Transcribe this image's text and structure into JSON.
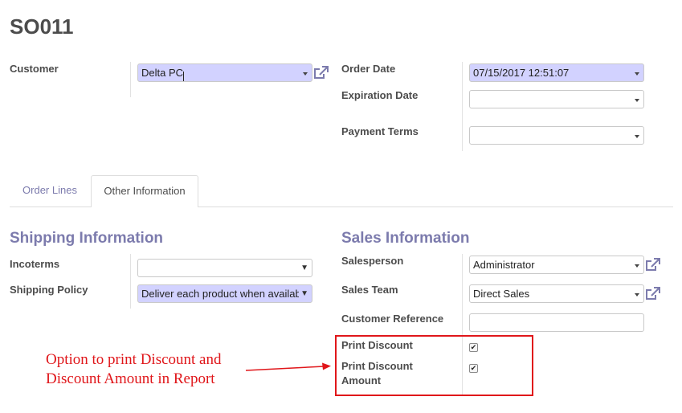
{
  "record": {
    "title": "SO011"
  },
  "header_fields": {
    "customer": {
      "label": "Customer",
      "value": "Delta PC"
    },
    "order_date": {
      "label": "Order Date",
      "value": "07/15/2017 12:51:07"
    },
    "expiration_date": {
      "label": "Expiration Date",
      "value": ""
    },
    "payment_terms": {
      "label": "Payment Terms",
      "value": ""
    }
  },
  "tabs": [
    {
      "label": "Order Lines",
      "active": false
    },
    {
      "label": "Other Information",
      "active": true
    }
  ],
  "shipping": {
    "heading": "Shipping Information",
    "incoterms": {
      "label": "Incoterms",
      "value": ""
    },
    "shipping_policy": {
      "label": "Shipping Policy",
      "value": "Deliver each product when available"
    }
  },
  "sales": {
    "heading": "Sales Information",
    "salesperson": {
      "label": "Salesperson",
      "value": "Administrator"
    },
    "sales_team": {
      "label": "Sales Team",
      "value": "Direct Sales"
    },
    "customer_reference": {
      "label": "Customer Reference",
      "value": ""
    },
    "print_discount": {
      "label": "Print Discount",
      "checked": true
    },
    "print_discount_amount": {
      "label_line1": "Print Discount",
      "label_line2": "Amount",
      "checked": true
    }
  },
  "annotation": {
    "line1": "Option to print Discount and",
    "line2": "Discount Amount in Report",
    "color": "#e0161a"
  },
  "icons": {
    "external_link": "external-link-icon",
    "dropdown": "chevron-down-icon"
  },
  "colors": {
    "accent": "#7c7bad",
    "required_field": "#d2d2ff",
    "highlight": "#e0161a"
  }
}
